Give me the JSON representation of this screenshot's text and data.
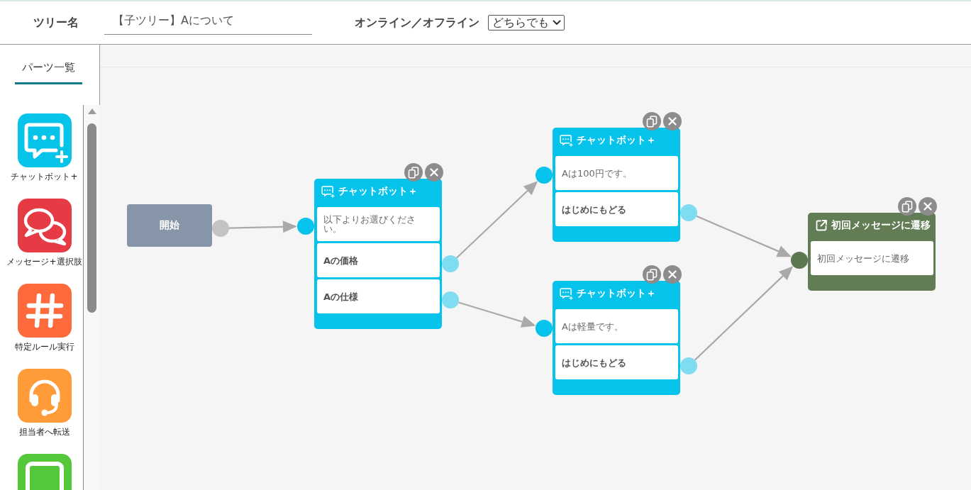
{
  "header": {
    "tree_name": {
      "label": "ツリー名",
      "value": "【子ツリー】Aについて"
    },
    "online_filter": {
      "label": "オンライン／オフライン",
      "value": "どちらでも"
    }
  },
  "sidebar": {
    "tabs": [
      {
        "label": "パーツ一覧",
        "selected": true
      }
    ],
    "parts": [
      {
        "kind": "chatbot",
        "label": "チャットボット+",
        "color": "#06c3ea"
      },
      {
        "kind": "message-choices",
        "label": "メッセージ+選択肢",
        "color": "#e63a45"
      },
      {
        "kind": "rule",
        "label": "特定ルール実行",
        "color": "#ff6a3c"
      },
      {
        "kind": "operator",
        "label": "担当者へ転送",
        "color": "#ff9b38"
      },
      {
        "kind": "screen",
        "color": "#55c73a"
      }
    ]
  },
  "canvas": {
    "nodes": [
      {
        "kind": "start",
        "label": "開始"
      },
      {
        "kind": "chatbot",
        "title": "チャットボット＋",
        "rows": [
          {
            "kind": "message",
            "text": "以下よりお選びください。"
          },
          {
            "kind": "choice",
            "text": "Aの価格"
          },
          {
            "kind": "choice",
            "text": "Aの仕様"
          }
        ]
      },
      {
        "kind": "chatbot",
        "title": "チャットボット＋",
        "rows": [
          {
            "kind": "message",
            "text": "Aは100円です。"
          },
          {
            "kind": "choice",
            "text": "はじめにもどる"
          }
        ]
      },
      {
        "kind": "chatbot",
        "title": "チャットボット＋",
        "rows": [
          {
            "kind": "message",
            "text": "Aは軽量です。"
          },
          {
            "kind": "choice",
            "text": "はじめにもどる"
          }
        ]
      },
      {
        "kind": "jump",
        "title": "初回メッセージに遷移",
        "rows": [
          {
            "kind": "message",
            "text": "初回メッセージに遷移"
          }
        ]
      }
    ]
  }
}
